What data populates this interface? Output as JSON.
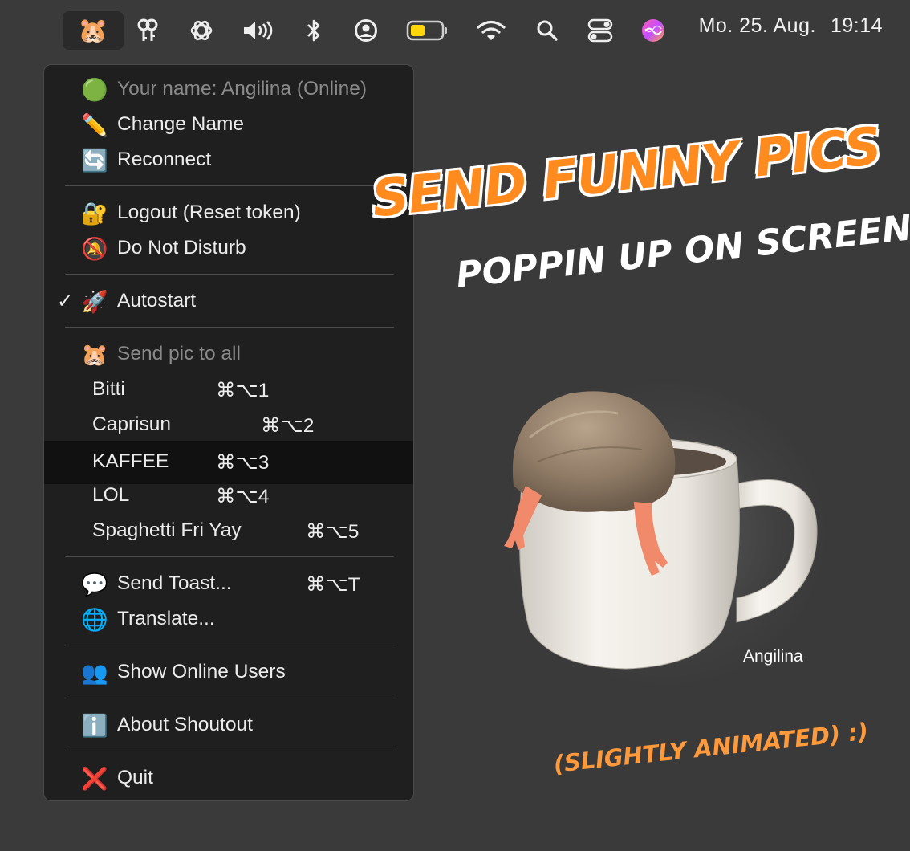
{
  "menubar": {
    "app_emoji": "🐹",
    "status_icons": [
      "keychain-icon",
      "openai-icon",
      "volume-icon",
      "bluetooth-icon",
      "user-circle-icon",
      "battery-icon",
      "wifi-icon",
      "search-icon",
      "control-center-icon",
      "siri-icon"
    ],
    "date": "Mo. 25. Aug.",
    "time": "19:14",
    "battery_color": "#ffd60a"
  },
  "menu": {
    "status": {
      "emoji": "🟢",
      "label": "Your name: Angilina (Online)"
    },
    "change_name": {
      "emoji": "✏️",
      "label": "Change Name"
    },
    "reconnect": {
      "emoji": "🔄",
      "label": "Reconnect"
    },
    "logout": {
      "emoji": "🔐",
      "label": "Logout (Reset token)"
    },
    "dnd": {
      "emoji": "🔕",
      "label": "Do Not Disturb"
    },
    "autostart": {
      "check": "✓",
      "emoji": "🚀",
      "label": "Autostart",
      "checked": true
    },
    "send_pic_header": {
      "emoji": "🐹",
      "label": "Send pic to all"
    },
    "pics": [
      {
        "label": "Bitti",
        "shortcut": "⌘⌥1"
      },
      {
        "label": "Caprisun",
        "shortcut": "⌘⌥2"
      },
      {
        "label": "KAFFEE",
        "shortcut": "⌘⌥3"
      },
      {
        "label": "LOL",
        "shortcut": "⌘⌥4"
      },
      {
        "label": "Spaghetti Fri Yay",
        "shortcut": "⌘⌥5"
      }
    ],
    "send_toast": {
      "emoji": "💬",
      "label": "Send Toast...",
      "shortcut": "⌘⌥T"
    },
    "translate": {
      "emoji": "🌐",
      "label": "Translate..."
    },
    "online_users": {
      "emoji": "👥",
      "label": "Show Online Users"
    },
    "about": {
      "emoji": "ℹ️",
      "label": "About Shoutout"
    },
    "quit": {
      "emoji": "❌",
      "label": "Quit"
    }
  },
  "promo": {
    "headline": "Send funny pics",
    "subline": "Poppin up on screen",
    "note": "(slightly animated) :)"
  },
  "popup": {
    "name": "Angilina"
  },
  "colors": {
    "accent_orange": "#ff8a1e",
    "menu_bg": "#1f1f1f",
    "desktop_bg": "#3a3a3a"
  }
}
